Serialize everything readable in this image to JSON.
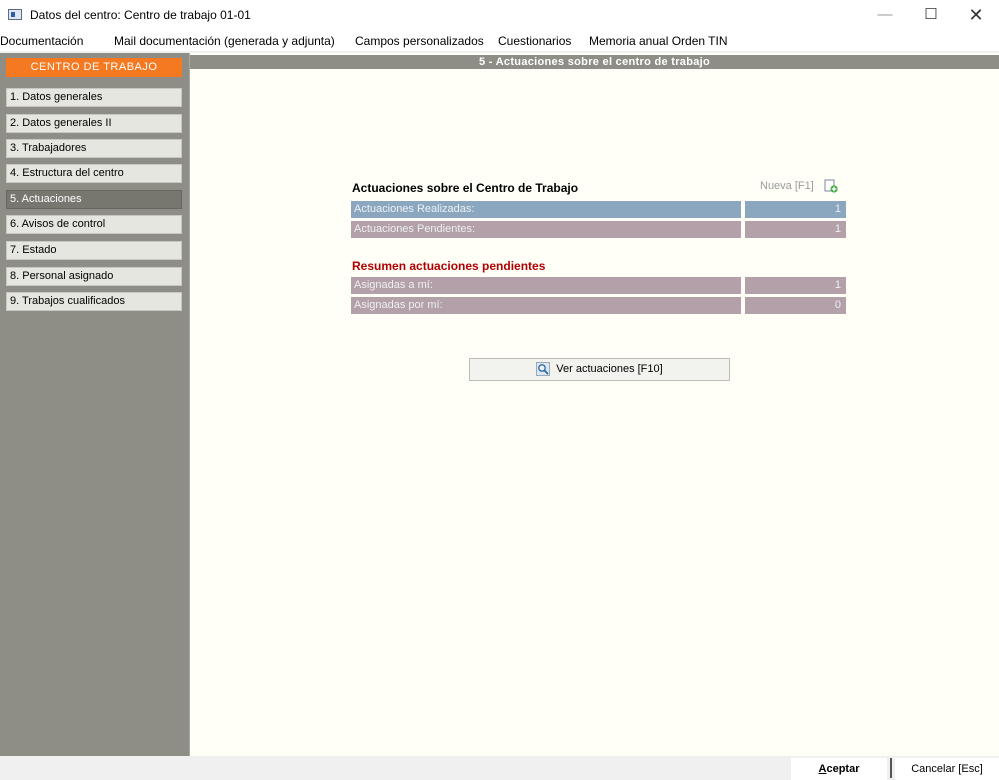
{
  "window": {
    "title": "Datos del centro: Centro de trabajo 01-01",
    "minimize": "—",
    "maximize": "☐",
    "close": "✕"
  },
  "menu": [
    "Documentación",
    "Mail documentación (generada y adjunta)",
    "Campos personalizados",
    "Cuestionarios",
    "Memoria anual Orden TIN"
  ],
  "sidebar": {
    "header": "CENTRO DE TRABAJO",
    "items": [
      {
        "label": "1. Datos generales"
      },
      {
        "label": "2. Datos generales II"
      },
      {
        "label": "3. Trabajadores"
      },
      {
        "label": "4. Estructura del centro"
      },
      {
        "label": "5. Actuaciones"
      },
      {
        "label": "6. Avisos de control"
      },
      {
        "label": "7. Estado"
      },
      {
        "label": "8. Personal asignado"
      },
      {
        "label": "9. Trabajos cualificados"
      }
    ]
  },
  "main": {
    "header": "5 - Actuaciones sobre el centro de trabajo",
    "section_title": "Actuaciones sobre el Centro de Trabajo",
    "new_label": "Nueva [F1]",
    "rows": [
      {
        "label": "Actuaciones Realizadas:",
        "value": "1"
      },
      {
        "label": "Actuaciones Pendientes:",
        "value": "1"
      }
    ],
    "summary_title": "Resumen actuaciones pendientes",
    "summary_rows": [
      {
        "label": "Asignadas a mí:",
        "value": "1"
      },
      {
        "label": "Asignadas por mí:",
        "value": "0"
      }
    ],
    "view_button": "Ver actuaciones  [F10]"
  },
  "footer": {
    "accept_underlined": "A",
    "accept_rest": "ceptar",
    "cancel": "Cancelar [Esc]"
  },
  "colors": {
    "sidebar_header": "#f47920",
    "sidebar_bg": "#8e8e87",
    "row_blue": "#8ba7c0",
    "row_mauve": "#b3a0a8",
    "summary_title": "#b00000"
  }
}
